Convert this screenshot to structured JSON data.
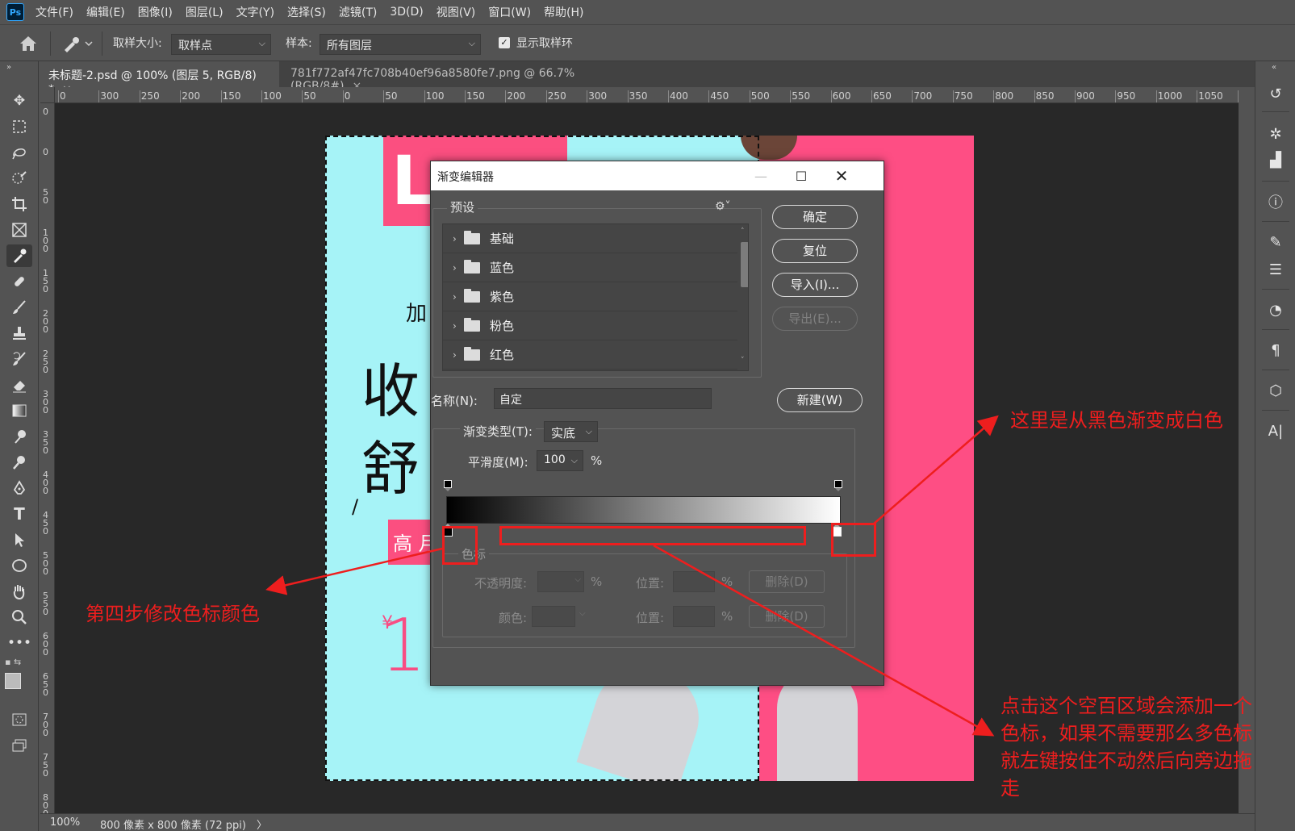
{
  "app": {
    "logo": "Ps",
    "menu": [
      "文件(F)",
      "编辑(E)",
      "图像(I)",
      "图层(L)",
      "文字(Y)",
      "选择(S)",
      "滤镜(T)",
      "3D(D)",
      "视图(V)",
      "窗口(W)",
      "帮助(H)"
    ]
  },
  "options": {
    "sample_size_label": "取样大小:",
    "sample_size_value": "取样点",
    "sample_label": "样本:",
    "sample_value": "所有图层",
    "show_ring_label": "显示取样环",
    "show_ring_checked": true
  },
  "tabs": [
    {
      "label": "未标题-2.psd @ 100% (图层 5, RGB/8) *",
      "close": "×"
    },
    {
      "label": "781f772af47fc708b40ef96a8580fe7.png @ 66.7%(RGB/8#)",
      "close": "×"
    }
  ],
  "ruler": {
    "h_ticks": [
      "0",
      "300",
      "250",
      "200",
      "150",
      "100",
      "50",
      "0",
      "50",
      "100",
      "150",
      "200",
      "250",
      "300",
      "350",
      "400",
      "450",
      "500",
      "550",
      "600",
      "650",
      "700",
      "750",
      "800",
      "850",
      "900",
      "950",
      "1000",
      "1050",
      "1100"
    ],
    "v_ticks": [
      "0",
      "0",
      "5 0",
      "1 0 0",
      "1 5 0",
      "2 0 0",
      "2 5 0",
      "3 0 0",
      "3 5 0",
      "4 0 0",
      "4 5 0",
      "5 0 0",
      "5 5 0",
      "6 0 0",
      "6 5 0",
      "7 0 0",
      "7 5 0",
      "8 0 0"
    ]
  },
  "document": {
    "logo_letter": "L",
    "text_jia": "加",
    "text_shou": "收",
    "text_shu": "舒",
    "text_slash": "/",
    "tag_text": "高 月",
    "price_symbol": "¥",
    "price": "1",
    "colors": {
      "cyan": "#a6f3f7",
      "pink": "#fe4e84"
    }
  },
  "status": {
    "zoom": "100%",
    "info": "800 像素 x 800 像素 (72 ppi)",
    "arrow": "〉"
  },
  "dialog": {
    "title": "渐变编辑器",
    "presets_legend": "预设",
    "presets": [
      "基础",
      "蓝色",
      "紫色",
      "粉色",
      "红色"
    ],
    "buttons": {
      "ok": "确定",
      "reset": "复位",
      "import": "导入(I)...",
      "export": "导出(E)...",
      "new": "新建(W)"
    },
    "name_label": "名称(N):",
    "name_value": "自定",
    "gradient_type_label": "渐变类型(T):",
    "gradient_type_value": "实底",
    "smoothness_label": "平滑度(M):",
    "smoothness_value": "100",
    "percent": "%",
    "color_stops_legend": "色标",
    "opacity_label": "不透明度:",
    "location_label": "位置:",
    "delete_label": "删除(D)",
    "color_label": "颜色:",
    "gradient_from": "#000000",
    "gradient_to": "#ffffff"
  },
  "annotations": {
    "black_to_white": "这里是从黑色渐变成白色",
    "step4": "第四步修改色标颜色",
    "click_blank_lines": [
      "点击这个空百区域会添加一个",
      "色标，如果不需要那么多色标",
      "就左键按住不动然后向旁边拖",
      "走"
    ],
    "color": "#ee1e1e"
  }
}
